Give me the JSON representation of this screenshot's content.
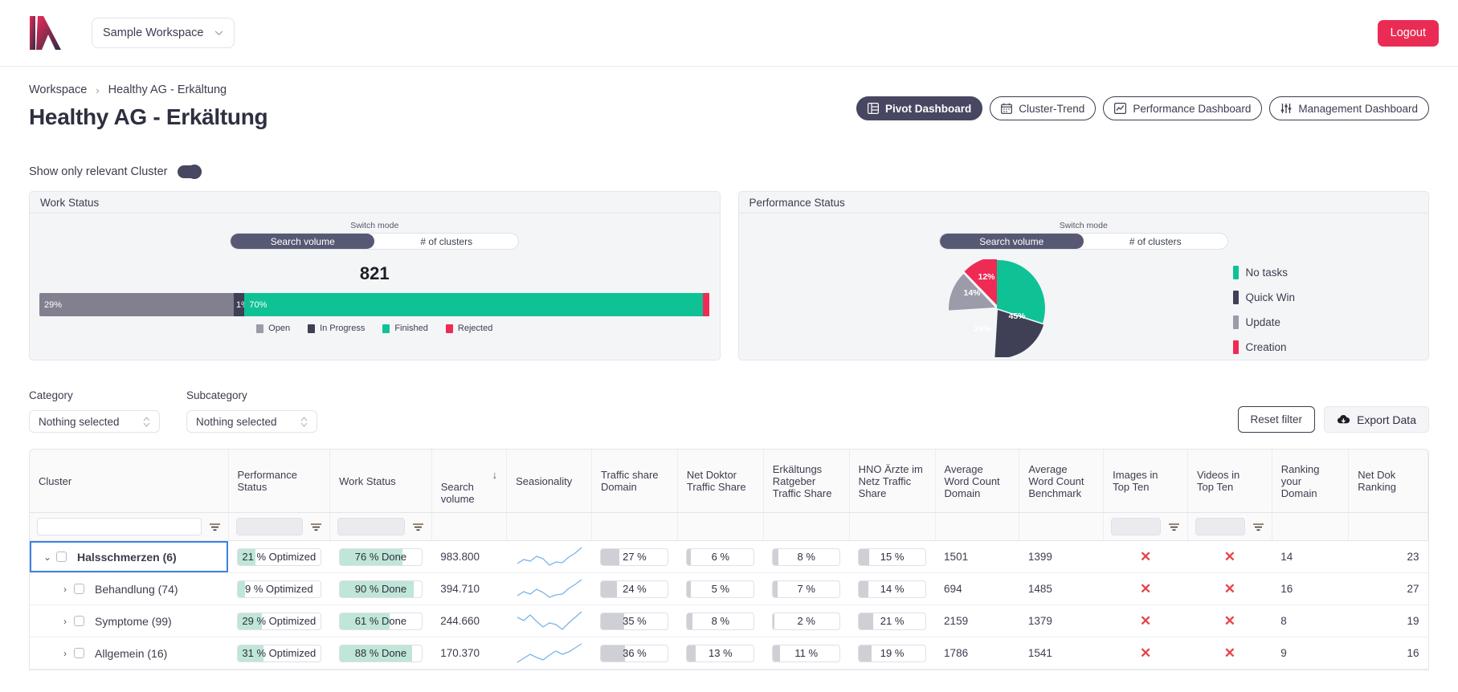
{
  "header": {
    "workspace_selector": "Sample Workspace",
    "logout_label": "Logout",
    "logo_name": "kaspar-logo"
  },
  "breadcrumb": {
    "root": "Workspace",
    "separator": "›",
    "current": "Healthy AG - Erkältung"
  },
  "page_title": "Healthy AG - Erkältung",
  "dashboard_tabs": [
    {
      "label": "Pivot Dashboard",
      "icon": "table-icon",
      "active": true
    },
    {
      "label": "Cluster-Trend",
      "icon": "calendar-icon",
      "active": false
    },
    {
      "label": "Performance Dashboard",
      "icon": "line-chart-icon",
      "active": false
    },
    {
      "label": "Management Dashboard",
      "icon": "sliders-icon",
      "active": false
    }
  ],
  "relevant_cluster_toggle": {
    "label": "Show only relevant Cluster",
    "state": "on"
  },
  "work_status_panel": {
    "title": "Work Status",
    "switch_mode_label": "Switch mode",
    "modes": [
      "Search volume",
      "# of clusters"
    ],
    "selected_mode": "Search volume",
    "total": "821"
  },
  "performance_status_panel": {
    "title": "Performance Status",
    "switch_mode_label": "Switch mode",
    "modes": [
      "Search volume",
      "# of clusters"
    ],
    "selected_mode": "Search volume"
  },
  "filters": {
    "category_label": "Category",
    "category_value": "Nothing selected",
    "subcategory_label": "Subcategory",
    "subcategory_value": "Nothing selected",
    "reset_label": "Reset filter",
    "export_label": "Export Data",
    "cluster_filter_value": ""
  },
  "colors": {
    "brand_pink": "#ea2c55",
    "dark": "#474761",
    "open_gray": "#82808f",
    "in_progress": "#3f3f56",
    "finished_green": "#0fc296",
    "rejected_pink": "#ef2b55",
    "update_gray": "#9b9baa",
    "pill_green": "#bfe6d6",
    "pill_gray": "#cfcfd6",
    "x_red": "#e8434a"
  },
  "chart_data": [
    {
      "type": "bar",
      "orientation": "horizontal-stacked",
      "title": "Work Status",
      "total_label": "821",
      "categories": [
        "Open",
        "In Progress",
        "Finished",
        "Rejected"
      ],
      "values": [
        29,
        1,
        70,
        0.5
      ],
      "bar_labels": [
        "29%",
        "1%",
        "70%",
        ""
      ],
      "colors": [
        "#82808f",
        "#3f3f56",
        "#0fc296",
        "#ef2b55"
      ],
      "legend": [
        "Open",
        "In Progress",
        "Finished",
        "Rejected"
      ],
      "legend_position": "bottom",
      "xlabel": "",
      "ylabel": "",
      "grid": false
    },
    {
      "type": "pie",
      "title": "Performance Status",
      "labels": [
        "No tasks",
        "Quick Win",
        "Update",
        "Creation"
      ],
      "values": [
        45,
        29,
        14,
        12
      ],
      "value_labels": [
        "45%",
        "29%",
        "14%",
        "12%"
      ],
      "colors": [
        "#0fc296",
        "#3f3f56",
        "#9b9baa",
        "#ef2b55"
      ],
      "legend": [
        "No tasks",
        "Quick Win",
        "Update",
        "Creation"
      ],
      "legend_position": "right"
    }
  ],
  "table": {
    "columns": [
      {
        "label": "Cluster",
        "filter": "text"
      },
      {
        "label": "Performance\nStatus",
        "filter": "gray"
      },
      {
        "label": "Work Status",
        "filter": "gray"
      },
      {
        "label": "Search\nvolume",
        "sorted": "desc",
        "filter": "none"
      },
      {
        "label": "Seasionality",
        "filter": "none"
      },
      {
        "label": "Traffic share\nDomain",
        "filter": "none"
      },
      {
        "label": "Net Doktor\nTraffic Share",
        "filter": "none"
      },
      {
        "label": "Erkältungs\nRatgeber\nTraffic Share",
        "filter": "none"
      },
      {
        "label": "HNO Ärzte im\nNetz Traffic\nShare",
        "filter": "none"
      },
      {
        "label": "Average\nWord Count\nDomain",
        "filter": "none"
      },
      {
        "label": "Average\nWord Count\nBenchmark",
        "filter": "none"
      },
      {
        "label": "Images in\nTop Ten",
        "filter": "gray"
      },
      {
        "label": "Videos in\nTop Ten",
        "filter": "gray"
      },
      {
        "label": "Ranking\nyour\nDomain",
        "filter": "none"
      },
      {
        "label": "Net Dok\nRanking",
        "filter": "none"
      }
    ],
    "sort_arrow": "↓",
    "rows": [
      {
        "level": 0,
        "expanded": true,
        "selected": true,
        "cluster": "Halsschmerzen (6)",
        "performance_status": {
          "text": "21 % Optimized",
          "pct": 21
        },
        "work_status": {
          "text": "76 % Done",
          "pct": 76
        },
        "search_volume": "983.800",
        "traffic_share_domain": {
          "text": "27 %",
          "pct": 27
        },
        "net_doktor": {
          "text": "6 %",
          "pct": 6
        },
        "erkaeltungs_ratgeber": {
          "text": "8 %",
          "pct": 8
        },
        "hno_aerzte": {
          "text": "15 %",
          "pct": 15
        },
        "avg_word_count_domain": "1501",
        "avg_word_count_benchmark": "1399",
        "images_top_ten": "✕",
        "videos_top_ten": "✕",
        "ranking_your_domain": "14",
        "net_dok_ranking": "23"
      },
      {
        "level": 1,
        "expanded": false,
        "selected": false,
        "cluster": "Behandlung (74)",
        "performance_status": {
          "text": "9 % Optimized",
          "pct": 9
        },
        "work_status": {
          "text": "90 % Done",
          "pct": 90
        },
        "search_volume": "394.710",
        "traffic_share_domain": {
          "text": "24 %",
          "pct": 24
        },
        "net_doktor": {
          "text": "5 %",
          "pct": 5
        },
        "erkaeltungs_ratgeber": {
          "text": "7 %",
          "pct": 7
        },
        "hno_aerzte": {
          "text": "14 %",
          "pct": 14
        },
        "avg_word_count_domain": "694",
        "avg_word_count_benchmark": "1485",
        "images_top_ten": "✕",
        "videos_top_ten": "✕",
        "ranking_your_domain": "16",
        "net_dok_ranking": "27"
      },
      {
        "level": 1,
        "expanded": false,
        "selected": false,
        "cluster": "Symptome (99)",
        "performance_status": {
          "text": "29 % Optimized",
          "pct": 29
        },
        "work_status": {
          "text": "61 % Done",
          "pct": 61
        },
        "search_volume": "244.660",
        "traffic_share_domain": {
          "text": "35 %",
          "pct": 35
        },
        "net_doktor": {
          "text": "8 %",
          "pct": 8
        },
        "erkaeltungs_ratgeber": {
          "text": "2 %",
          "pct": 2
        },
        "hno_aerzte": {
          "text": "21 %",
          "pct": 21
        },
        "avg_word_count_domain": "2159",
        "avg_word_count_benchmark": "1379",
        "images_top_ten": "✕",
        "videos_top_ten": "✕",
        "ranking_your_domain": "8",
        "net_dok_ranking": "19"
      },
      {
        "level": 1,
        "expanded": false,
        "selected": false,
        "cluster": "Allgemein (16)",
        "performance_status": {
          "text": "31 % Optimized",
          "pct": 31
        },
        "work_status": {
          "text": "88 % Done",
          "pct": 88
        },
        "search_volume": "170.370",
        "traffic_share_domain": {
          "text": "36 %",
          "pct": 36
        },
        "net_doktor": {
          "text": "13 %",
          "pct": 13
        },
        "erkaeltungs_ratgeber": {
          "text": "11 %",
          "pct": 11
        },
        "hno_aerzte": {
          "text": "19 %",
          "pct": 19
        },
        "avg_word_count_domain": "1786",
        "avg_word_count_benchmark": "1541",
        "images_top_ten": "✕",
        "videos_top_ten": "✕",
        "ranking_your_domain": "9",
        "net_dok_ranking": "16"
      }
    ]
  }
}
